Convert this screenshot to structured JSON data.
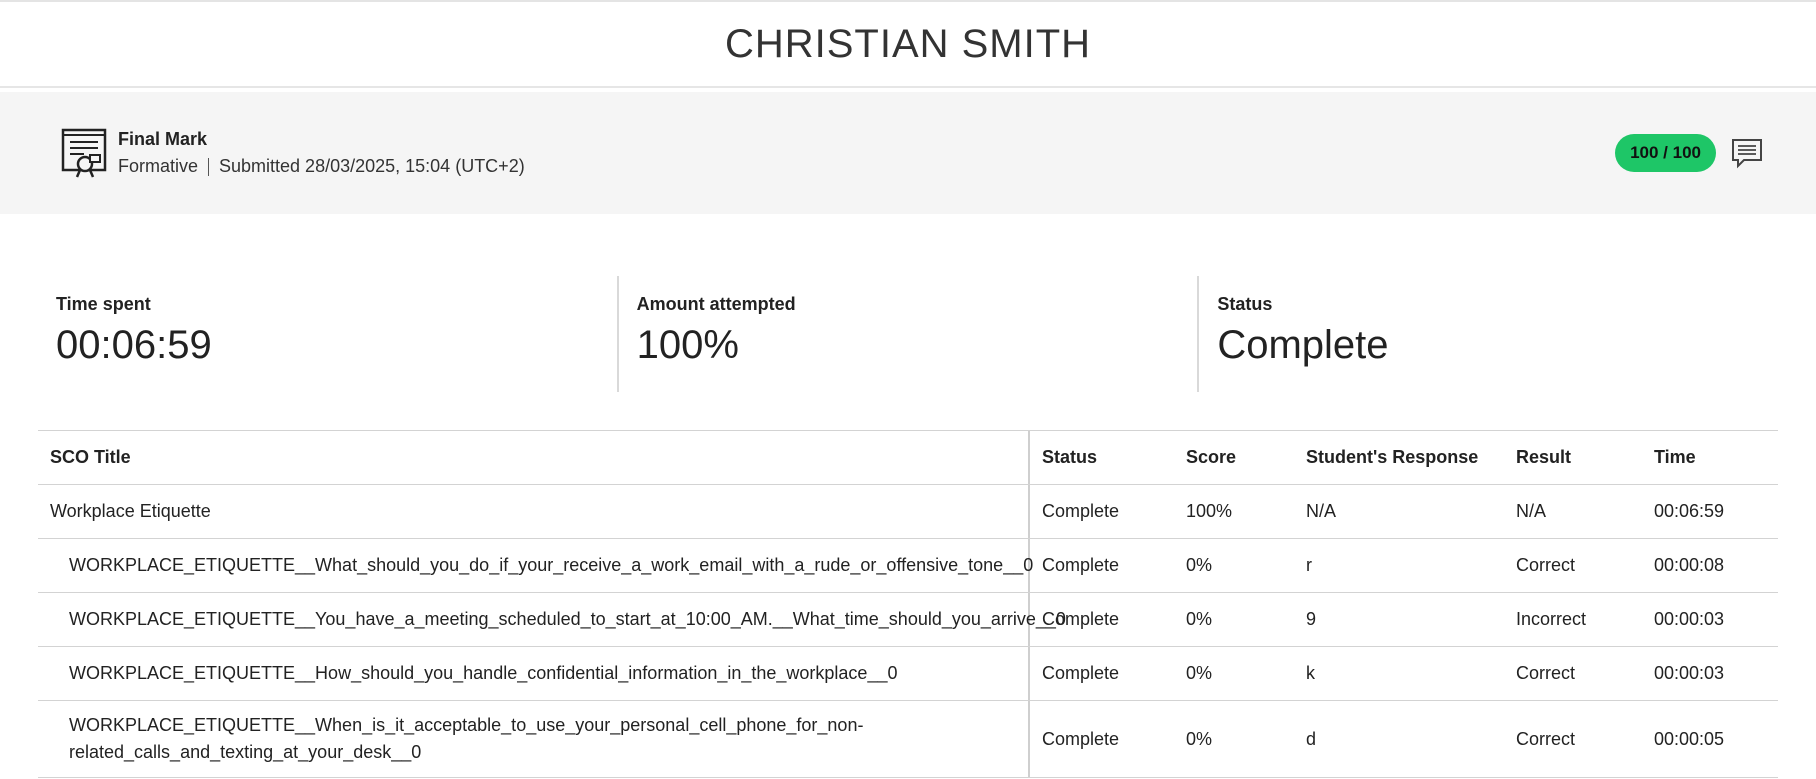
{
  "student": {
    "name": "CHRISTIAN SMITH"
  },
  "final_mark": {
    "title": "Final Mark",
    "type": "Formative",
    "submitted": "Submitted 28/03/2025, 15:04 (UTC+2)",
    "score": "100 / 100",
    "certificate_icon": "certificate-icon",
    "comment_icon": "comment-icon"
  },
  "stats": {
    "time_spent": {
      "label": "Time spent",
      "value": "00:06:59"
    },
    "amount_attempted": {
      "label": "Amount attempted",
      "value": "100%"
    },
    "status": {
      "label": "Status",
      "value": "Complete"
    }
  },
  "table": {
    "headers": {
      "title": "SCO Title",
      "status": "Status",
      "score": "Score",
      "response": "Student's Response",
      "result": "Result",
      "time": "Time"
    },
    "rows": [
      {
        "title": "Workplace Etiquette",
        "status": "Complete",
        "score": "100%",
        "response": "N/A",
        "result": "N/A",
        "time": "00:06:59"
      },
      {
        "title": "WORKPLACE_ETIQUETTE__What_should_you_do_if_your_receive_a_work_email_with_a_rude_or_offensive_tone__0",
        "status": "Complete",
        "score": "0%",
        "response": "r",
        "result": "Correct",
        "time": "00:00:08"
      },
      {
        "title": "WORKPLACE_ETIQUETTE__You_have_a_meeting_scheduled_to_start_at_10:00_AM.__What_time_should_you_arrive__0",
        "status": "Complete",
        "score": "0%",
        "response": "9",
        "result": "Incorrect",
        "time": "00:00:03"
      },
      {
        "title": "WORKPLACE_ETIQUETTE__How_should_you_handle_confidential_information_in_the_workplace__0",
        "status": "Complete",
        "score": "0%",
        "response": "k",
        "result": "Correct",
        "time": "00:00:03"
      },
      {
        "title_line1": "WORKPLACE_ETIQUETTE__When_is_it_acceptable_to_use_your_personal_cell_phone_for_non-",
        "title_line2": "related_calls_and_texting_at_your_desk__0",
        "status": "Complete",
        "score": "0%",
        "response": "d",
        "result": "Correct",
        "time": "00:00:05"
      }
    ]
  }
}
